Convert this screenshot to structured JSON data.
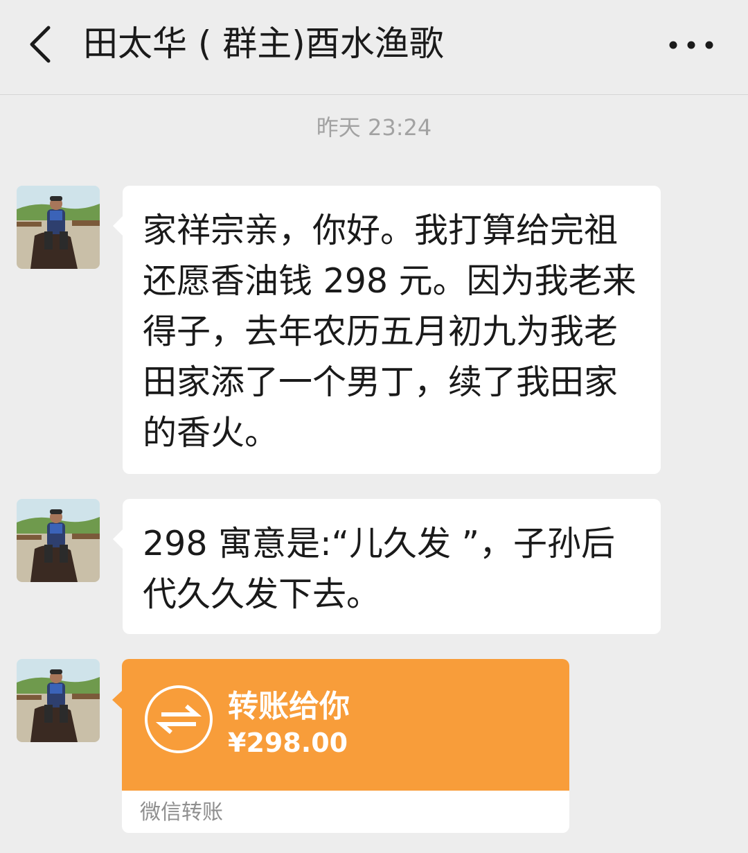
{
  "header": {
    "title": "田太华 ( 群主)酉水渔歌",
    "back_icon": "chevron-left-icon",
    "more_icon": "more-dots-icon"
  },
  "chat": {
    "timestamp": "昨天 23:24",
    "messages": [
      {
        "type": "text",
        "text": "家祥宗亲，你好。我打算给完祖还愿香油钱 298 元。因为我老来得子，去年农历五月初九为我老田家添了一个男丁，续了我田家的香火。"
      },
      {
        "type": "text",
        "text": "298 寓意是:“儿久发 ”，子孙后代久久发下去。"
      },
      {
        "type": "transfer",
        "title": "转账给你",
        "amount": "¥298.00",
        "footer": "微信转账",
        "icon": "transfer-arrows-icon"
      }
    ]
  },
  "colors": {
    "background": "#ededed",
    "bubble": "#ffffff",
    "transfer_orange": "#f89d3a",
    "timestamp_text": "#a2a2a2"
  }
}
